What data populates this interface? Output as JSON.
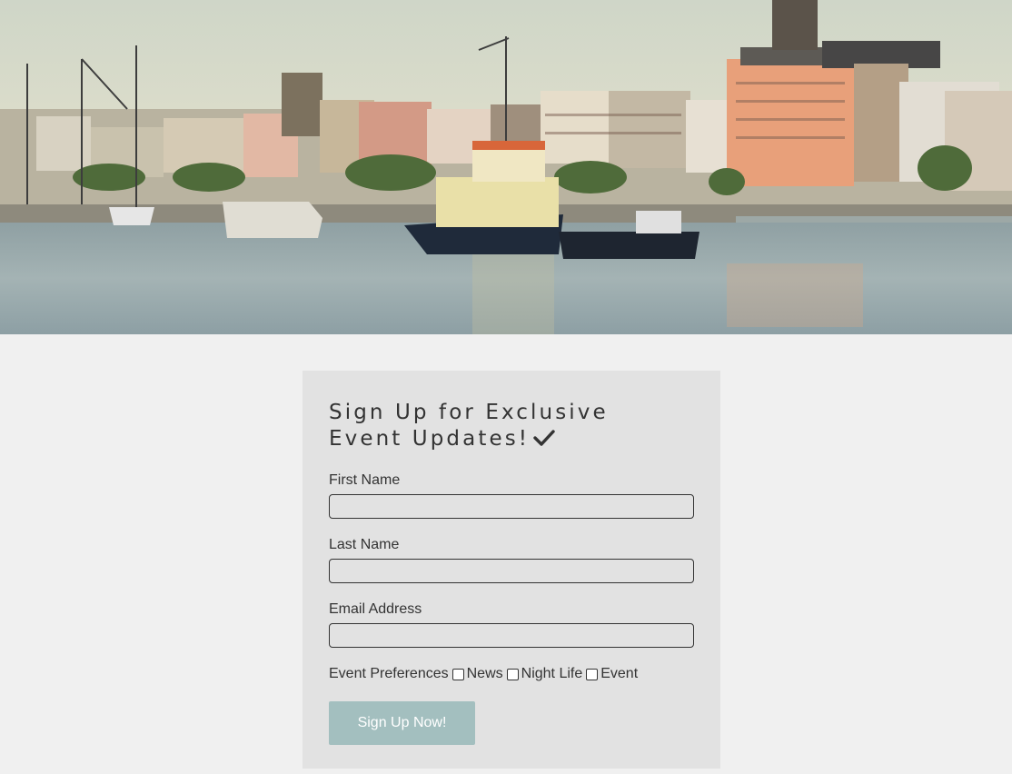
{
  "hero": {
    "image": "harbour-quay-panorama",
    "colors": {
      "sky": "#d9dccb",
      "water": "#9fb0b5",
      "buildings_warm": "#e8a07a"
    }
  },
  "form": {
    "title": "Sign Up for Exclusive Event Updates!",
    "title_icon": "check-icon",
    "fields": {
      "first_name": {
        "label": "First Name",
        "value": ""
      },
      "last_name": {
        "label": "Last Name",
        "value": ""
      },
      "email": {
        "label": "Email Address",
        "value": ""
      }
    },
    "preferences": {
      "label": "Event Preferences",
      "options": [
        {
          "label": "News",
          "checked": false
        },
        {
          "label": "Night Life",
          "checked": false
        },
        {
          "label": "Event",
          "checked": false
        }
      ]
    },
    "submit_label": "Sign Up Now!",
    "colors": {
      "card": "#e2e2e2",
      "button": "#a3bfbf",
      "page": "#f0f0f0"
    }
  }
}
